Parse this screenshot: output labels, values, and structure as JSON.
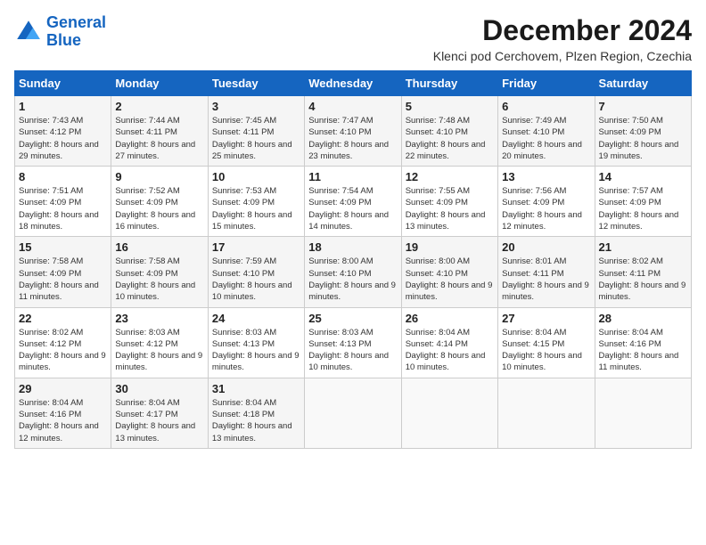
{
  "logo": {
    "line1": "General",
    "line2": "Blue"
  },
  "title": "December 2024",
  "location": "Klenci pod Cerchovem, Plzen Region, Czechia",
  "headers": [
    "Sunday",
    "Monday",
    "Tuesday",
    "Wednesday",
    "Thursday",
    "Friday",
    "Saturday"
  ],
  "weeks": [
    [
      {
        "day": "1",
        "sunrise": "Sunrise: 7:43 AM",
        "sunset": "Sunset: 4:12 PM",
        "daylight": "Daylight: 8 hours and 29 minutes."
      },
      {
        "day": "2",
        "sunrise": "Sunrise: 7:44 AM",
        "sunset": "Sunset: 4:11 PM",
        "daylight": "Daylight: 8 hours and 27 minutes."
      },
      {
        "day": "3",
        "sunrise": "Sunrise: 7:45 AM",
        "sunset": "Sunset: 4:11 PM",
        "daylight": "Daylight: 8 hours and 25 minutes."
      },
      {
        "day": "4",
        "sunrise": "Sunrise: 7:47 AM",
        "sunset": "Sunset: 4:10 PM",
        "daylight": "Daylight: 8 hours and 23 minutes."
      },
      {
        "day": "5",
        "sunrise": "Sunrise: 7:48 AM",
        "sunset": "Sunset: 4:10 PM",
        "daylight": "Daylight: 8 hours and 22 minutes."
      },
      {
        "day": "6",
        "sunrise": "Sunrise: 7:49 AM",
        "sunset": "Sunset: 4:10 PM",
        "daylight": "Daylight: 8 hours and 20 minutes."
      },
      {
        "day": "7",
        "sunrise": "Sunrise: 7:50 AM",
        "sunset": "Sunset: 4:09 PM",
        "daylight": "Daylight: 8 hours and 19 minutes."
      }
    ],
    [
      {
        "day": "8",
        "sunrise": "Sunrise: 7:51 AM",
        "sunset": "Sunset: 4:09 PM",
        "daylight": "Daylight: 8 hours and 18 minutes."
      },
      {
        "day": "9",
        "sunrise": "Sunrise: 7:52 AM",
        "sunset": "Sunset: 4:09 PM",
        "daylight": "Daylight: 8 hours and 16 minutes."
      },
      {
        "day": "10",
        "sunrise": "Sunrise: 7:53 AM",
        "sunset": "Sunset: 4:09 PM",
        "daylight": "Daylight: 8 hours and 15 minutes."
      },
      {
        "day": "11",
        "sunrise": "Sunrise: 7:54 AM",
        "sunset": "Sunset: 4:09 PM",
        "daylight": "Daylight: 8 hours and 14 minutes."
      },
      {
        "day": "12",
        "sunrise": "Sunrise: 7:55 AM",
        "sunset": "Sunset: 4:09 PM",
        "daylight": "Daylight: 8 hours and 13 minutes."
      },
      {
        "day": "13",
        "sunrise": "Sunrise: 7:56 AM",
        "sunset": "Sunset: 4:09 PM",
        "daylight": "Daylight: 8 hours and 12 minutes."
      },
      {
        "day": "14",
        "sunrise": "Sunrise: 7:57 AM",
        "sunset": "Sunset: 4:09 PM",
        "daylight": "Daylight: 8 hours and 12 minutes."
      }
    ],
    [
      {
        "day": "15",
        "sunrise": "Sunrise: 7:58 AM",
        "sunset": "Sunset: 4:09 PM",
        "daylight": "Daylight: 8 hours and 11 minutes."
      },
      {
        "day": "16",
        "sunrise": "Sunrise: 7:58 AM",
        "sunset": "Sunset: 4:09 PM",
        "daylight": "Daylight: 8 hours and 10 minutes."
      },
      {
        "day": "17",
        "sunrise": "Sunrise: 7:59 AM",
        "sunset": "Sunset: 4:10 PM",
        "daylight": "Daylight: 8 hours and 10 minutes."
      },
      {
        "day": "18",
        "sunrise": "Sunrise: 8:00 AM",
        "sunset": "Sunset: 4:10 PM",
        "daylight": "Daylight: 8 hours and 9 minutes."
      },
      {
        "day": "19",
        "sunrise": "Sunrise: 8:00 AM",
        "sunset": "Sunset: 4:10 PM",
        "daylight": "Daylight: 8 hours and 9 minutes."
      },
      {
        "day": "20",
        "sunrise": "Sunrise: 8:01 AM",
        "sunset": "Sunset: 4:11 PM",
        "daylight": "Daylight: 8 hours and 9 minutes."
      },
      {
        "day": "21",
        "sunrise": "Sunrise: 8:02 AM",
        "sunset": "Sunset: 4:11 PM",
        "daylight": "Daylight: 8 hours and 9 minutes."
      }
    ],
    [
      {
        "day": "22",
        "sunrise": "Sunrise: 8:02 AM",
        "sunset": "Sunset: 4:12 PM",
        "daylight": "Daylight: 8 hours and 9 minutes."
      },
      {
        "day": "23",
        "sunrise": "Sunrise: 8:03 AM",
        "sunset": "Sunset: 4:12 PM",
        "daylight": "Daylight: 8 hours and 9 minutes."
      },
      {
        "day": "24",
        "sunrise": "Sunrise: 8:03 AM",
        "sunset": "Sunset: 4:13 PM",
        "daylight": "Daylight: 8 hours and 9 minutes."
      },
      {
        "day": "25",
        "sunrise": "Sunrise: 8:03 AM",
        "sunset": "Sunset: 4:13 PM",
        "daylight": "Daylight: 8 hours and 10 minutes."
      },
      {
        "day": "26",
        "sunrise": "Sunrise: 8:04 AM",
        "sunset": "Sunset: 4:14 PM",
        "daylight": "Daylight: 8 hours and 10 minutes."
      },
      {
        "day": "27",
        "sunrise": "Sunrise: 8:04 AM",
        "sunset": "Sunset: 4:15 PM",
        "daylight": "Daylight: 8 hours and 10 minutes."
      },
      {
        "day": "28",
        "sunrise": "Sunrise: 8:04 AM",
        "sunset": "Sunset: 4:16 PM",
        "daylight": "Daylight: 8 hours and 11 minutes."
      }
    ],
    [
      {
        "day": "29",
        "sunrise": "Sunrise: 8:04 AM",
        "sunset": "Sunset: 4:16 PM",
        "daylight": "Daylight: 8 hours and 12 minutes."
      },
      {
        "day": "30",
        "sunrise": "Sunrise: 8:04 AM",
        "sunset": "Sunset: 4:17 PM",
        "daylight": "Daylight: 8 hours and 13 minutes."
      },
      {
        "day": "31",
        "sunrise": "Sunrise: 8:04 AM",
        "sunset": "Sunset: 4:18 PM",
        "daylight": "Daylight: 8 hours and 13 minutes."
      },
      null,
      null,
      null,
      null
    ]
  ]
}
